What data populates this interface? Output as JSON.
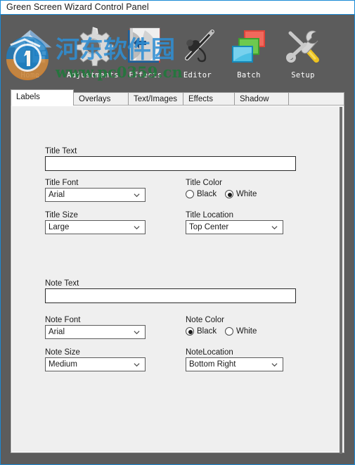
{
  "window": {
    "title": "Green Screen Wizard Control Panel"
  },
  "toolbar": {
    "items": [
      {
        "label": "Home",
        "icon": "home-icon"
      },
      {
        "label": "Adjustments",
        "icon": "gear-icon"
      },
      {
        "label": "Effects",
        "icon": "book-icon"
      },
      {
        "label": "Editor",
        "icon": "airbrush-icon"
      },
      {
        "label": "Batch",
        "icon": "stacked-images-icon"
      },
      {
        "label": "Setup",
        "icon": "tools-icon"
      }
    ]
  },
  "watermark": {
    "chinese": "河东软件园",
    "url": "www.pc0359.cn"
  },
  "tabs": [
    {
      "label": "Labels",
      "selected": true
    },
    {
      "label": "Overlays",
      "selected": false
    },
    {
      "label": "Text/Images",
      "selected": false
    },
    {
      "label": "Effects",
      "selected": false
    },
    {
      "label": "Shadow",
      "selected": false
    }
  ],
  "labels_tab": {
    "title_text": {
      "label": "Title Text",
      "value": "",
      "placeholder": ""
    },
    "title_font": {
      "label": "Title Font",
      "value": "Arial",
      "options": [
        "Arial"
      ]
    },
    "title_color": {
      "label": "Title Color",
      "options": [
        {
          "label": "Black",
          "selected": false
        },
        {
          "label": "White",
          "selected": true
        }
      ]
    },
    "title_size": {
      "label": "Title Size",
      "value": "Large",
      "options": [
        "Large"
      ]
    },
    "title_location": {
      "label": "Title Location",
      "value": "Top Center",
      "options": [
        "Top Center"
      ]
    },
    "note_text": {
      "label": "Note Text",
      "value": "",
      "placeholder": ""
    },
    "note_font": {
      "label": "Note Font",
      "value": "Arial",
      "options": [
        "Arial"
      ]
    },
    "note_color": {
      "label": "Note Color",
      "options": [
        {
          "label": "Black",
          "selected": true
        },
        {
          "label": "White",
          "selected": false
        }
      ]
    },
    "note_size": {
      "label": "Note Size",
      "value": "Medium",
      "options": [
        "Medium"
      ]
    },
    "note_location": {
      "label": "NoteLocation",
      "value": "Bottom Right",
      "options": [
        "Bottom Right"
      ]
    }
  },
  "colors": {
    "frame_blue": "#1b8ad6",
    "toolbar_gray": "#5c5c5c",
    "panel_bg": "#efefef",
    "tab_selected": "#ffffff",
    "tab_unselected": "#f0f0f0",
    "text": "#1a1a1a"
  }
}
